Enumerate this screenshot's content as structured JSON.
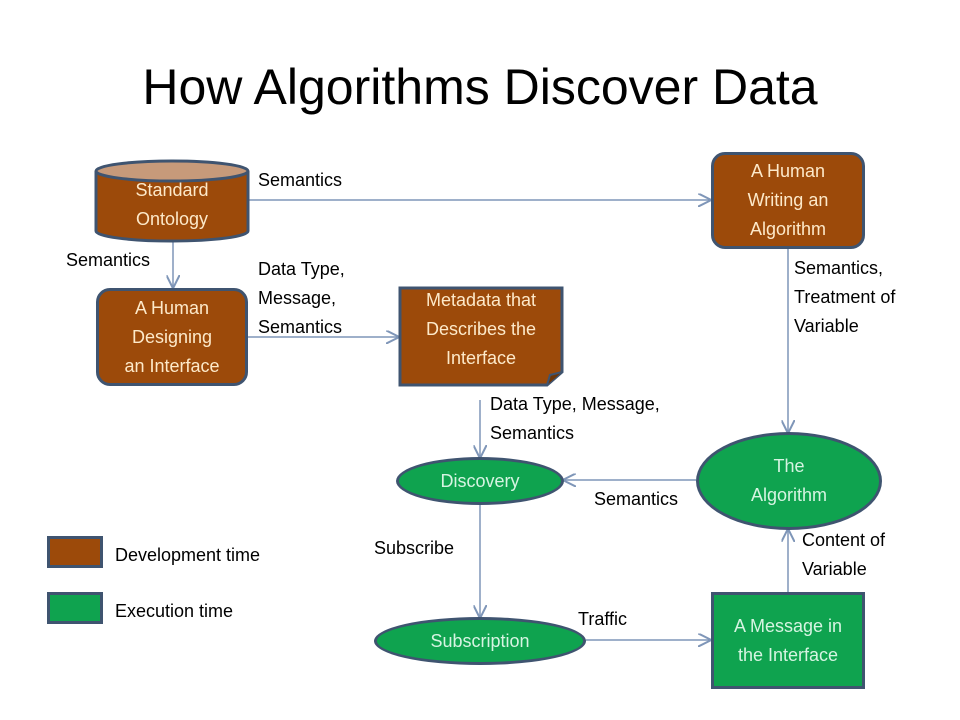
{
  "title": "How Algorithms Discover Data",
  "colors": {
    "development": "#9c4a0a",
    "execution": "#0fa34f",
    "border": "#3f5470",
    "edge": "#7f96b8"
  },
  "nodes": {
    "standard_ontology": {
      "lines": [
        "Standard",
        "Ontology"
      ],
      "type": "development",
      "shape": "cylinder"
    },
    "human_designing": {
      "lines": [
        "A Human",
        "Designing",
        "an Interface"
      ],
      "type": "development",
      "shape": "rounded-rectangle"
    },
    "metadata": {
      "lines": [
        "Metadata that",
        "Describes the",
        "Interface"
      ],
      "type": "development",
      "shape": "folded-note"
    },
    "human_writing": {
      "lines": [
        "A Human",
        "Writing an",
        "Algorithm"
      ],
      "type": "development",
      "shape": "rounded-rectangle"
    },
    "the_algorithm": {
      "lines": [
        "The",
        "Algorithm"
      ],
      "type": "execution",
      "shape": "ellipse"
    },
    "discovery": {
      "lines": [
        "Discovery"
      ],
      "type": "execution",
      "shape": "ellipse"
    },
    "subscription": {
      "lines": [
        "Subscription"
      ],
      "type": "execution",
      "shape": "ellipse"
    },
    "message": {
      "lines": [
        "A Message in",
        "the Interface"
      ],
      "type": "execution",
      "shape": "rectangle"
    }
  },
  "edges": [
    {
      "from": "standard_ontology",
      "to": "human_writing",
      "label": "Semantics"
    },
    {
      "from": "standard_ontology",
      "to": "human_designing",
      "label": "Semantics"
    },
    {
      "from": "human_designing",
      "to": "metadata",
      "label": "Data Type,\nMessage,\nSemantics"
    },
    {
      "from": "human_writing",
      "to": "the_algorithm",
      "label": "Semantics,\nTreatment of\nVariable"
    },
    {
      "from": "metadata",
      "to": "discovery",
      "label": "Data Type, Message,\nSemantics"
    },
    {
      "from": "the_algorithm",
      "to": "discovery",
      "label": "Semantics"
    },
    {
      "from": "discovery",
      "to": "subscription",
      "label": "Subscribe"
    },
    {
      "from": "subscription",
      "to": "message",
      "label": "Traffic"
    },
    {
      "from": "message",
      "to": "the_algorithm",
      "label": "Content of\nVariable"
    }
  ],
  "legend": [
    {
      "label": "Development time",
      "type": "development"
    },
    {
      "label": "Execution time",
      "type": "execution"
    }
  ]
}
